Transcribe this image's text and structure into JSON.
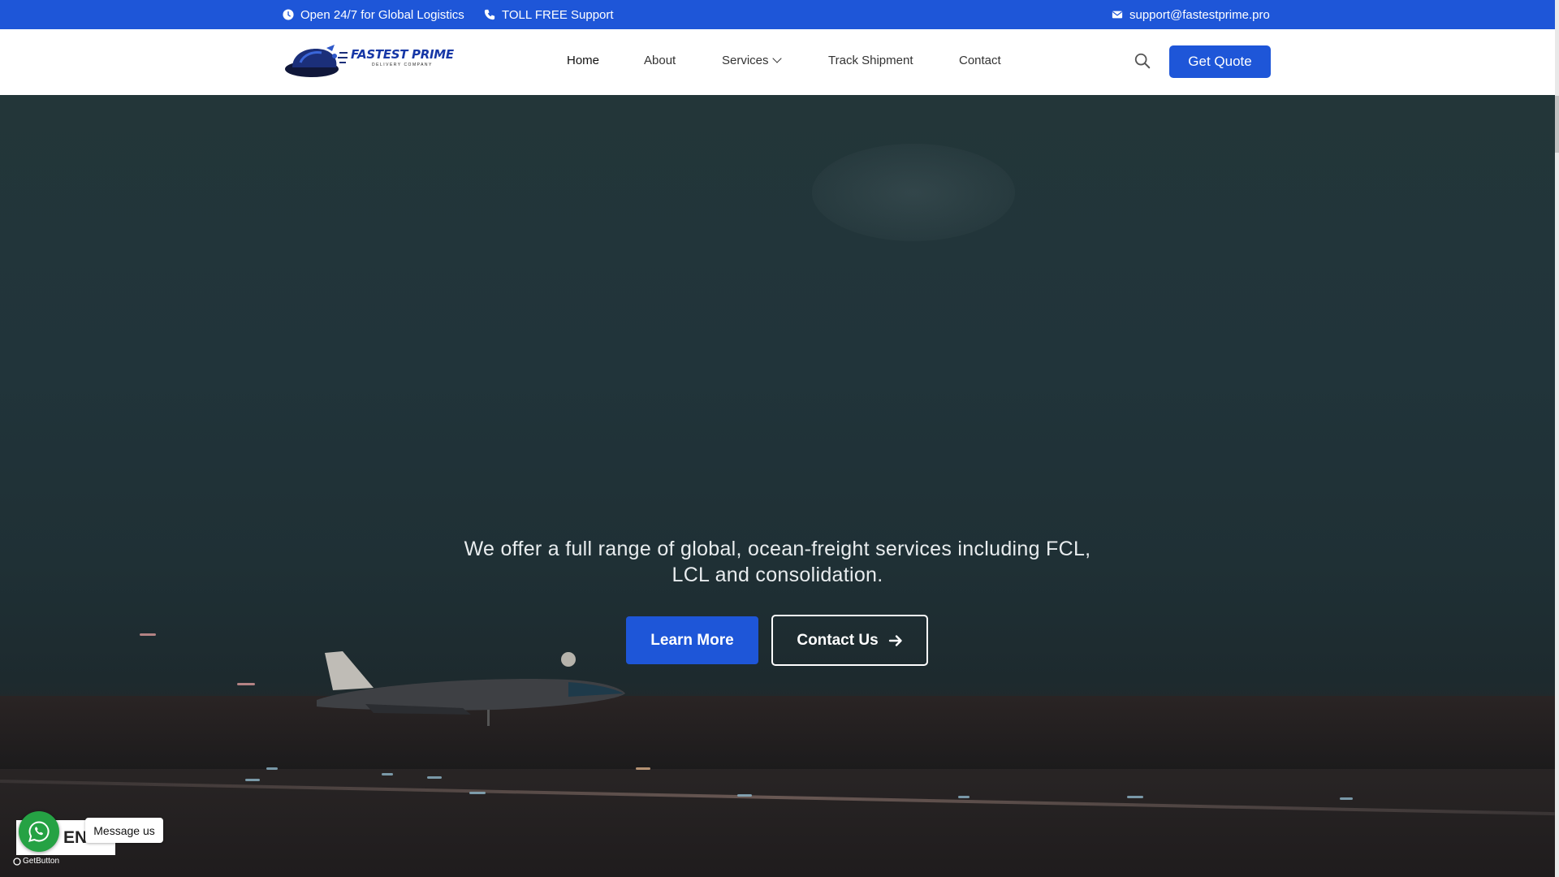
{
  "topbar": {
    "hours": "Open 24/7 for Global Logistics",
    "support": "TOLL FREE Support",
    "email": "support@fastestprime.pro"
  },
  "header": {
    "logo_title": "FASTEST PRIME",
    "logo_subtitle": "DELIVERY COMPANY",
    "nav": {
      "home": "Home",
      "about": "About",
      "services": "Services",
      "track": "Track Shipment",
      "contact": "Contact"
    },
    "quote_button": "Get Quote"
  },
  "hero": {
    "text": "We offer a full range of global, ocean-freight services including FCL, LCL and consolidation.",
    "learn_more": "Learn More",
    "contact_us": "Contact Us"
  },
  "widgets": {
    "language": "EN",
    "message": "Message us",
    "getbutton": "GetButton"
  },
  "colors": {
    "primary": "#1e56d8",
    "whatsapp": "#25a244"
  },
  "icons": [
    "clock-icon",
    "phone-icon",
    "mail-icon",
    "search-icon",
    "chevron-down-icon",
    "arrow-right-icon",
    "whatsapp-icon"
  ]
}
